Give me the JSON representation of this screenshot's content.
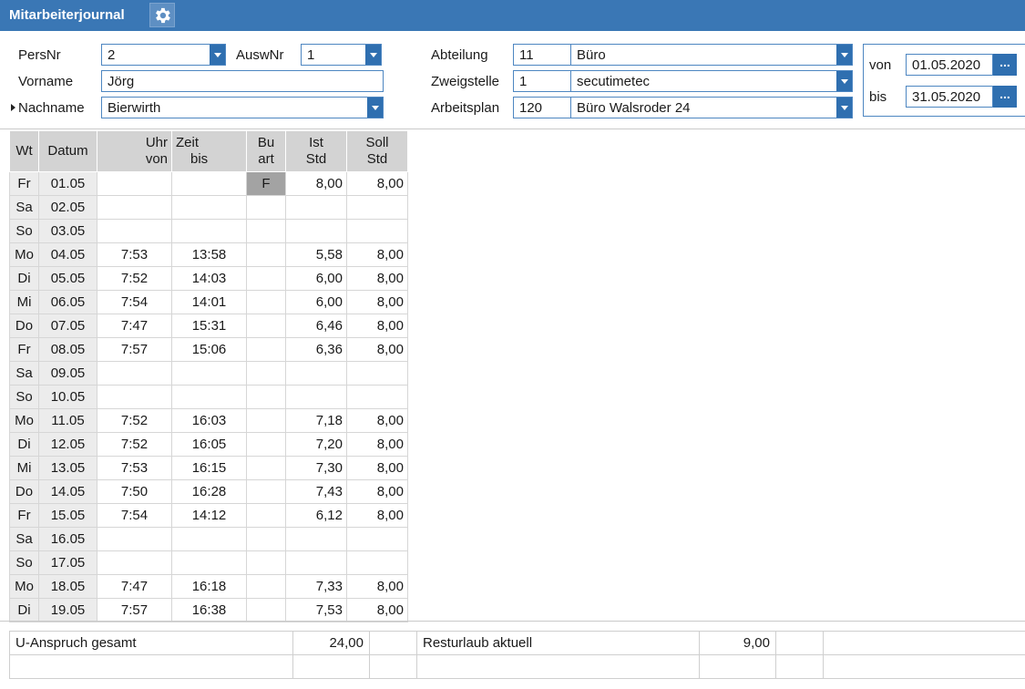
{
  "window": {
    "title": "Mitarbeiterjournal",
    "settings_icon": "gear-icon"
  },
  "header": {
    "persnr": {
      "label": "PersNr",
      "value": "2"
    },
    "auswnr": {
      "label": "AuswNr",
      "value": "1"
    },
    "vorname": {
      "label": "Vorname",
      "value": "Jörg"
    },
    "nachname": {
      "label": "Nachname",
      "value": "Bierwirth"
    },
    "abteilung": {
      "label": "Abteilung",
      "code": "11",
      "name": "Büro"
    },
    "zweigstelle": {
      "label": "Zweigstelle",
      "code": "1",
      "name": "secutimetec"
    },
    "arbeitsplan": {
      "label": "Arbeitsplan",
      "code": "120",
      "name": "Büro Walsroder 24"
    },
    "period": {
      "von_label": "von",
      "von_value": "01.05.2020",
      "bis_label": "bis",
      "bis_value": "31.05.2020",
      "picker_label": "..."
    }
  },
  "table": {
    "headers": {
      "wt": "Wt",
      "datum": "Datum",
      "uhr_top": "Uhr",
      "uhr_bottom": "von",
      "zeit_top": "Zeit",
      "zeit_bottom": "bis",
      "bu_top": "Bu",
      "bu_bottom": "art",
      "ist_top": "Ist",
      "ist_bottom": "Std",
      "soll_top": "Soll",
      "soll_bottom": "Std"
    },
    "rows": [
      {
        "wt": "Fr",
        "datum": "01.05",
        "von": "",
        "bis": "",
        "buart": "F",
        "ist": "8,00",
        "soll": "8,00"
      },
      {
        "wt": "Sa",
        "datum": "02.05",
        "von": "",
        "bis": "",
        "buart": "",
        "ist": "",
        "soll": ""
      },
      {
        "wt": "So",
        "datum": "03.05",
        "von": "",
        "bis": "",
        "buart": "",
        "ist": "",
        "soll": ""
      },
      {
        "wt": "Mo",
        "datum": "04.05",
        "von": "7:53",
        "bis": "13:58",
        "buart": "",
        "ist": "5,58",
        "soll": "8,00"
      },
      {
        "wt": "Di",
        "datum": "05.05",
        "von": "7:52",
        "bis": "14:03",
        "buart": "",
        "ist": "6,00",
        "soll": "8,00"
      },
      {
        "wt": "Mi",
        "datum": "06.05",
        "von": "7:54",
        "bis": "14:01",
        "buart": "",
        "ist": "6,00",
        "soll": "8,00"
      },
      {
        "wt": "Do",
        "datum": "07.05",
        "von": "7:47",
        "bis": "15:31",
        "buart": "",
        "ist": "6,46",
        "soll": "8,00"
      },
      {
        "wt": "Fr",
        "datum": "08.05",
        "von": "7:57",
        "bis": "15:06",
        "buart": "",
        "ist": "6,36",
        "soll": "8,00"
      },
      {
        "wt": "Sa",
        "datum": "09.05",
        "von": "",
        "bis": "",
        "buart": "",
        "ist": "",
        "soll": ""
      },
      {
        "wt": "So",
        "datum": "10.05",
        "von": "",
        "bis": "",
        "buart": "",
        "ist": "",
        "soll": ""
      },
      {
        "wt": "Mo",
        "datum": "11.05",
        "von": "7:52",
        "bis": "16:03",
        "buart": "",
        "ist": "7,18",
        "soll": "8,00"
      },
      {
        "wt": "Di",
        "datum": "12.05",
        "von": "7:52",
        "bis": "16:05",
        "buart": "",
        "ist": "7,20",
        "soll": "8,00"
      },
      {
        "wt": "Mi",
        "datum": "13.05",
        "von": "7:53",
        "bis": "16:15",
        "buart": "",
        "ist": "7,30",
        "soll": "8,00"
      },
      {
        "wt": "Do",
        "datum": "14.05",
        "von": "7:50",
        "bis": "16:28",
        "buart": "",
        "ist": "7,43",
        "soll": "8,00"
      },
      {
        "wt": "Fr",
        "datum": "15.05",
        "von": "7:54",
        "bis": "14:12",
        "buart": "",
        "ist": "6,12",
        "soll": "8,00"
      },
      {
        "wt": "Sa",
        "datum": "16.05",
        "von": "",
        "bis": "",
        "buart": "",
        "ist": "",
        "soll": ""
      },
      {
        "wt": "So",
        "datum": "17.05",
        "von": "",
        "bis": "",
        "buart": "",
        "ist": "",
        "soll": ""
      },
      {
        "wt": "Mo",
        "datum": "18.05",
        "von": "7:47",
        "bis": "16:18",
        "buart": "",
        "ist": "7,33",
        "soll": "8,00"
      },
      {
        "wt": "Di",
        "datum": "19.05",
        "von": "7:57",
        "bis": "16:38",
        "buart": "",
        "ist": "7,53",
        "soll": "8,00"
      }
    ]
  },
  "summary": {
    "u_anspruch_label": "U-Anspruch gesamt",
    "u_anspruch_value": "24,00",
    "resturlaub_label": "Resturlaub aktuell",
    "resturlaub_value": "9,00"
  }
}
